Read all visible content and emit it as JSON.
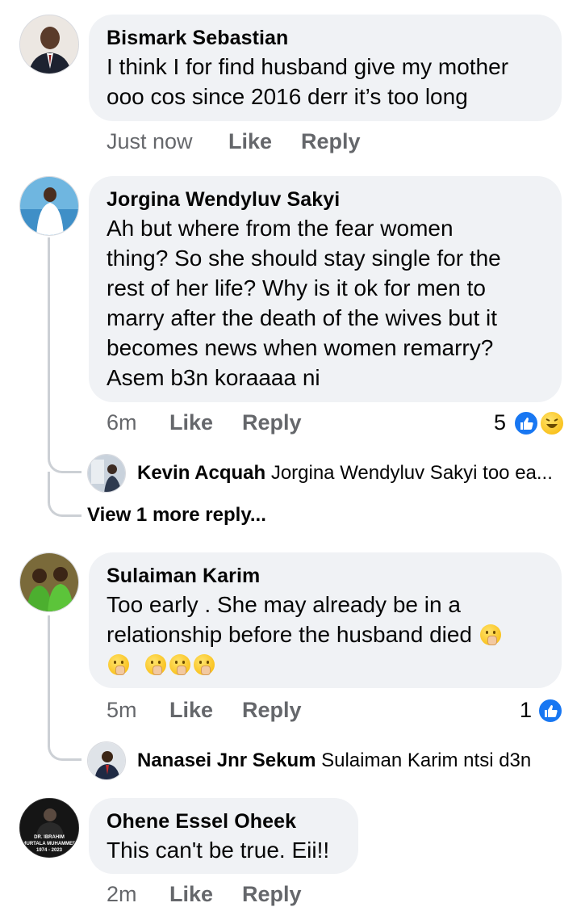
{
  "comments": [
    {
      "author": "Bismark Sebastian",
      "lines": [
        "I think I for find husband give my mother",
        "ooo cos since 2016 derr it’s too long"
      ],
      "time": "Just now",
      "like": "Like",
      "reply": "Reply"
    },
    {
      "author": "Jorgina Wendyluv Sakyi",
      "lines": [
        "Ah but where from the fear women",
        "thing? So she should stay single for the",
        "rest of her life? Why is it ok for men to",
        "marry after the death of the wives but it",
        "becomes news when women remarry?",
        "Asem b3n koraaaa ni"
      ],
      "time": "6m",
      "like": "Like",
      "reply": "Reply",
      "reaction_count": "5",
      "reactions": [
        "like-icon",
        "haha-icon"
      ],
      "reply_preview": {
        "author": "Kevin Acquah",
        "text": "Jorgina Wendyluv Sakyi  too ea..."
      },
      "view_more": "View 1 more reply..."
    },
    {
      "author": "Sulaiman Karim",
      "lines": [
        "Too early . She may already be in a",
        "relationship before the husband died"
      ],
      "time": "5m",
      "like": "Like",
      "reply": "Reply",
      "reaction_count": "1",
      "reactions": [
        "like-icon"
      ],
      "reply_preview": {
        "author": "Nanasei Jnr Sekum",
        "text": "Sulaiman Karim ntsi d3n"
      }
    },
    {
      "author": "Ohene Essel Oheek",
      "lines": [
        "This can't be true. Eii!!"
      ],
      "time": "2m",
      "like": "Like",
      "reply": "Reply",
      "avatar_caption": [
        "DR. IBRAHIM",
        "MURTALA MUHAMMED",
        "1974 - 2023"
      ]
    }
  ],
  "colors": {
    "bubble": "#f0f2f5",
    "meta": "#65676b",
    "like_blue": "#1877f2",
    "thread": "#ccd0d5"
  }
}
